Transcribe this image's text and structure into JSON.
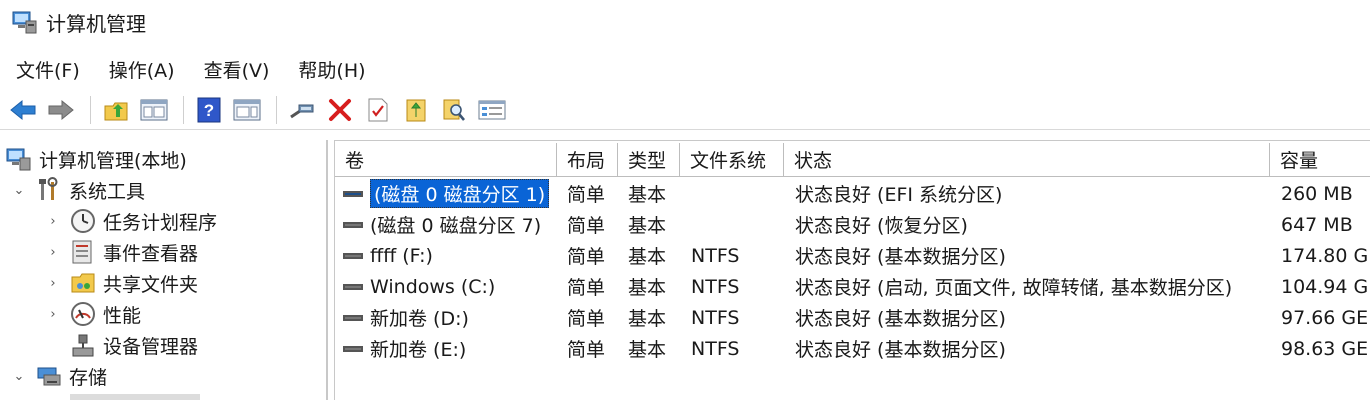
{
  "window": {
    "title": "计算机管理"
  },
  "menu": [
    {
      "id": "file",
      "label": "文件(F)"
    },
    {
      "id": "action",
      "label": "操作(A)"
    },
    {
      "id": "view",
      "label": "查看(V)"
    },
    {
      "id": "help",
      "label": "帮助(H)"
    }
  ],
  "tree": {
    "root": "计算机管理(本地)",
    "system_tools": "系统工具",
    "task_scheduler": "任务计划程序",
    "event_viewer": "事件查看器",
    "shared_folders": "共享文件夹",
    "performance": "性能",
    "device_manager": "设备管理器",
    "storage": "存储"
  },
  "table": {
    "columns": {
      "volume": "卷",
      "layout": "布局",
      "type": "类型",
      "filesystem": "文件系统",
      "status": "状态",
      "capacity": "容量"
    },
    "rows": [
      {
        "volume": "(磁盘 0 磁盘分区 1)",
        "layout": "简单",
        "type": "基本",
        "filesystem": "",
        "status": "状态良好 (EFI 系统分区)",
        "capacity": "260 MB"
      },
      {
        "volume": "(磁盘 0 磁盘分区 7)",
        "layout": "简单",
        "type": "基本",
        "filesystem": "",
        "status": "状态良好 (恢复分区)",
        "capacity": "647 MB"
      },
      {
        "volume": "ffff (F:)",
        "layout": "简单",
        "type": "基本",
        "filesystem": "NTFS",
        "status": "状态良好 (基本数据分区)",
        "capacity": "174.80 G"
      },
      {
        "volume": "Windows (C:)",
        "layout": "简单",
        "type": "基本",
        "filesystem": "NTFS",
        "status": "状态良好 (启动, 页面文件, 故障转储, 基本数据分区)",
        "capacity": "104.94 G"
      },
      {
        "volume": "新加卷 (D:)",
        "layout": "简单",
        "type": "基本",
        "filesystem": "NTFS",
        "status": "状态良好 (基本数据分区)",
        "capacity": "97.66 GE"
      },
      {
        "volume": "新加卷 (E:)",
        "layout": "简单",
        "type": "基本",
        "filesystem": "NTFS",
        "status": "状态良好 (基本数据分区)",
        "capacity": "98.63 GE"
      }
    ]
  },
  "colors": {
    "selection": "#0a64d6",
    "back_arrow": "#2e7fd1",
    "delete_red": "#d71d1d"
  }
}
